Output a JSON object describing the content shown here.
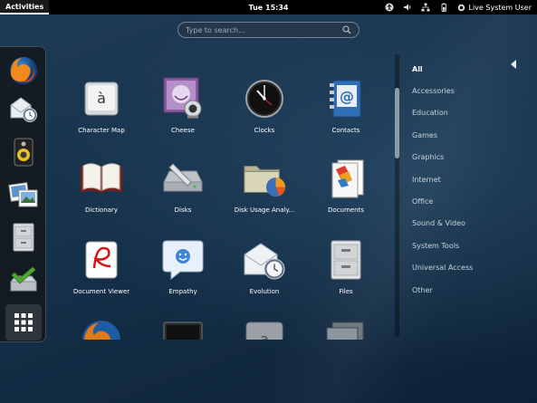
{
  "topbar": {
    "activities": "Activities",
    "clock": "Tue 15:34",
    "user": "Live System User"
  },
  "search": {
    "placeholder": "Type to search..."
  },
  "dash": {
    "items": [
      {
        "icon": "firefox-icon"
      },
      {
        "icon": "evolution-mail-icon"
      },
      {
        "icon": "rhythmbox-speaker-icon"
      },
      {
        "icon": "shotwell-photos-icon"
      },
      {
        "icon": "files-cabinet-icon"
      },
      {
        "icon": "software-install-icon"
      },
      {
        "icon": "show-applications-icon"
      }
    ]
  },
  "apps": [
    {
      "label": "Character Map",
      "icon": "character-map-icon"
    },
    {
      "label": "Cheese",
      "icon": "cheese-icon"
    },
    {
      "label": "Clocks",
      "icon": "clocks-icon"
    },
    {
      "label": "Contacts",
      "icon": "contacts-icon"
    },
    {
      "label": "Dictionary",
      "icon": "dictionary-icon"
    },
    {
      "label": "Disks",
      "icon": "disks-icon"
    },
    {
      "label": "Disk Usage Analy...",
      "icon": "disk-usage-icon"
    },
    {
      "label": "Documents",
      "icon": "documents-icon"
    },
    {
      "label": "Document Viewer",
      "icon": "document-viewer-icon"
    },
    {
      "label": "Empathy",
      "icon": "empathy-icon"
    },
    {
      "label": "Evolution",
      "icon": "evolution-icon"
    },
    {
      "label": "Files",
      "icon": "files-icon"
    },
    {
      "label": "",
      "icon": "firefox-partial-icon"
    },
    {
      "label": "",
      "icon": "monitor-partial-icon"
    },
    {
      "label": "",
      "icon": "font-viewer-partial-icon"
    },
    {
      "label": "",
      "icon": "screenshot-partial-icon"
    }
  ],
  "categories": [
    "All",
    "Accessories",
    "Education",
    "Games",
    "Graphics",
    "Internet",
    "Office",
    "Sound & Video",
    "System Tools",
    "Universal Access",
    "Other"
  ],
  "selected_category": "All"
}
